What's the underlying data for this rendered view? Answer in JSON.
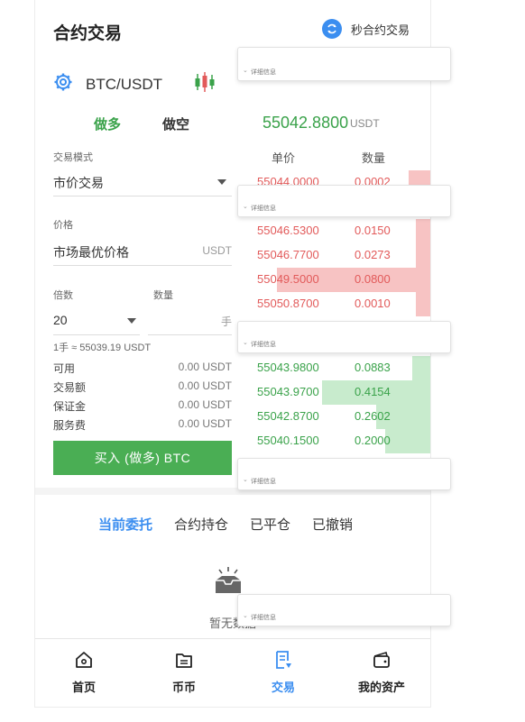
{
  "header": {
    "title": "合约交易",
    "second_trade_label": "秒合约交易"
  },
  "pair": {
    "symbol": "BTC/USDT"
  },
  "tabs": {
    "long": "做多",
    "short": "做空"
  },
  "ticker": {
    "price": "55042.8800",
    "unit": "USDT"
  },
  "orderbook": {
    "col_price": "单价",
    "col_qty": "数量",
    "asks": [
      {
        "price": "55044.0000",
        "qty": "0.0002",
        "depth": 0.12
      },
      {
        "price": "55046.5300",
        "qty": "0.0150",
        "depth": 0.08
      },
      {
        "price": "55046.7700",
        "qty": "0.0273",
        "depth": 0.08
      },
      {
        "price": "55049.5000",
        "qty": "0.0800",
        "depth": 0.85
      },
      {
        "price": "55050.8700",
        "qty": "0.0010",
        "depth": 0.08
      }
    ],
    "bids": [
      {
        "price": "55043.9800",
        "qty": "0.0883",
        "depth": 0.1
      },
      {
        "price": "55043.9700",
        "qty": "0.4154",
        "depth": 0.6
      },
      {
        "price": "55042.8700",
        "qty": "0.2602",
        "depth": 0.3
      },
      {
        "price": "55040.1500",
        "qty": "0.2000",
        "depth": 0.25
      }
    ]
  },
  "form": {
    "mode_label": "交易模式",
    "mode_value": "市价交易",
    "price_label": "价格",
    "price_value": "市场最优价格",
    "price_unit": "USDT",
    "leverage_label": "倍数",
    "qty_label": "数量",
    "leverage_value": "20",
    "qty_unit": "手",
    "conversion": "1手 ≈ 55039.19 USDT"
  },
  "stats": [
    {
      "label": "可用",
      "value": "0.00 USDT"
    },
    {
      "label": "交易额",
      "value": "0.00 USDT"
    },
    {
      "label": "保证金",
      "value": "0.00 USDT"
    },
    {
      "label": "服务费",
      "value": "0.00 USDT"
    }
  ],
  "buy_button": "买入 (做多) BTC",
  "order_tabs": [
    "当前委托",
    "合约持仓",
    "已平仓",
    "已撤销"
  ],
  "empty": {
    "text": "暂无数据"
  },
  "nav": [
    {
      "label": "首页",
      "icon": "home-icon"
    },
    {
      "label": "币币",
      "icon": "exchange-icon"
    },
    {
      "label": "交易",
      "icon": "trade-icon"
    },
    {
      "label": "我的资产",
      "icon": "wallet-icon"
    }
  ],
  "overlay": {
    "details_label": "详细信息"
  },
  "colors": {
    "green": "#3aa24a",
    "red": "#e25a5a",
    "blue": "#3b8ef0",
    "buy": "#4aae54"
  }
}
